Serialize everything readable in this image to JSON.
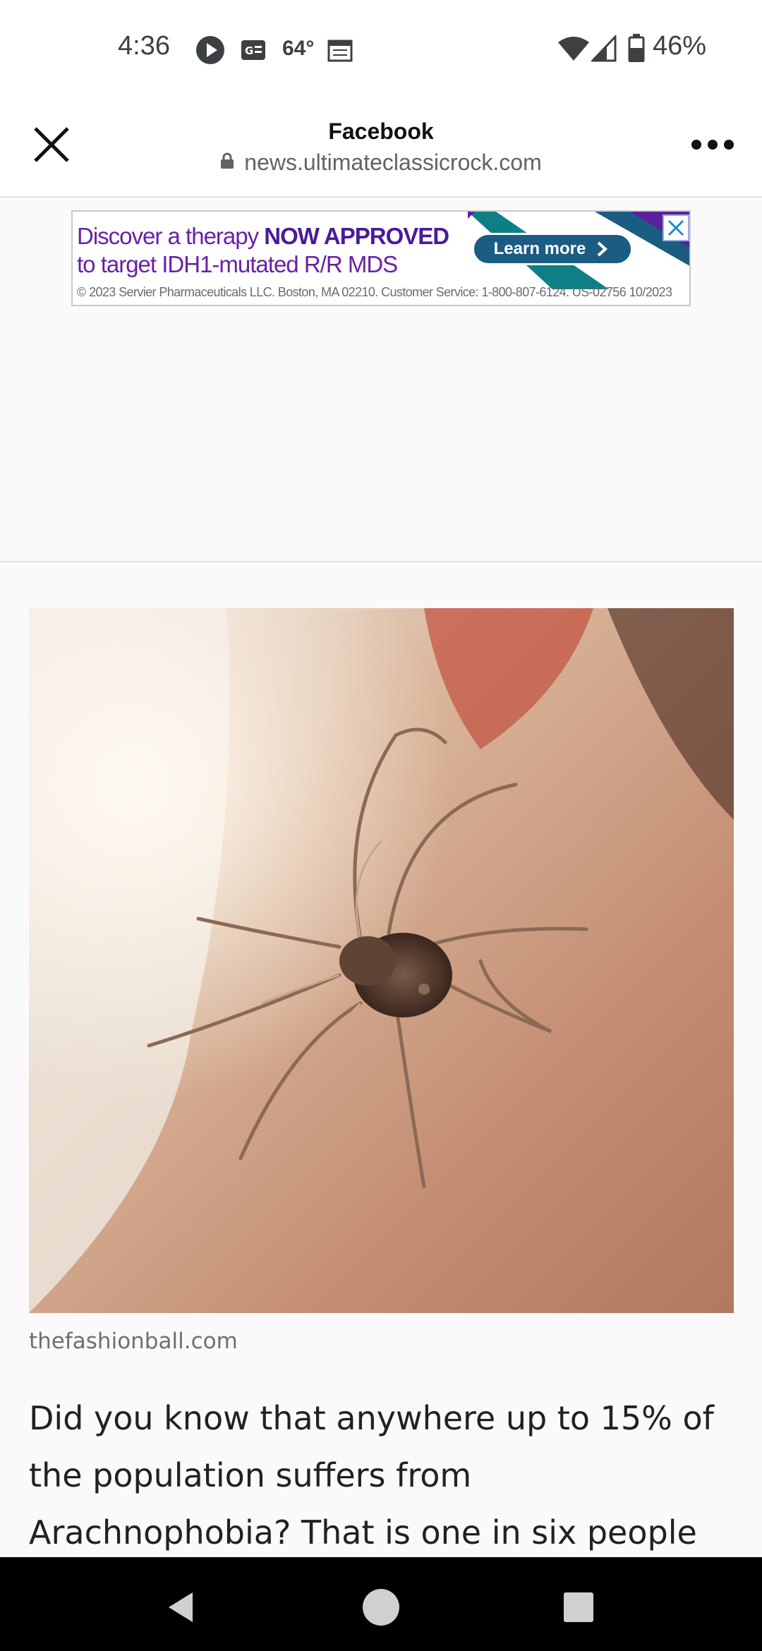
{
  "status_bar": {
    "time": "4:36",
    "temperature": "64°",
    "battery": "46%",
    "icons": [
      "play-icon",
      "news-icon",
      "calendar-icon",
      "wifi-icon",
      "signal-icon",
      "battery-icon"
    ]
  },
  "browser": {
    "title": "Facebook",
    "url": "news.ultimateclassicrock.com",
    "icons": [
      "close-icon",
      "lock-icon",
      "more-icon"
    ]
  },
  "ad": {
    "line1_normal": "Discover a therapy ",
    "line1_bold": "NOW APPROVED",
    "line2": "to target IDH1-mutated R/R MDS",
    "cta": "Learn more",
    "legal": "© 2023 Servier Pharmaceuticals LLC. Boston, MA 02210. Customer Service: 1-800-807-6124.  US-02756  10/2023",
    "colors": {
      "purple": "#5b1f9f",
      "teal": "#1a5c82"
    }
  },
  "article": {
    "image_credit": "thefashionball.com",
    "body_text": "Did you know that anywhere up to 15% of the population suffers from Arachnophobia? That is one in six people"
  },
  "nav": {
    "icons": [
      "back-icon",
      "home-icon",
      "recents-icon"
    ]
  }
}
